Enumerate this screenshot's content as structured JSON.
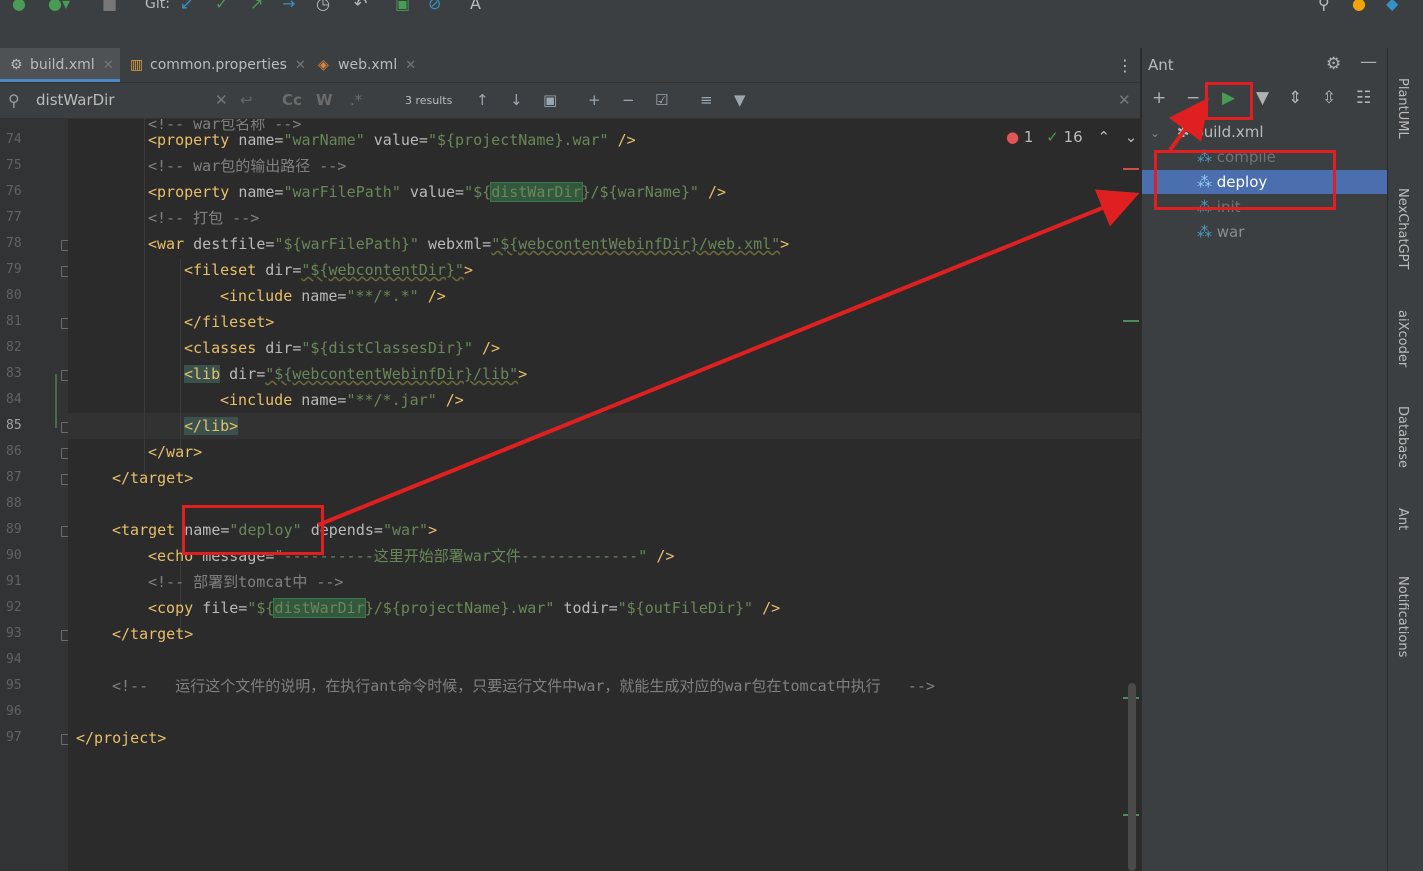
{
  "toolbar": {
    "git_label": "Git:"
  },
  "tabs": [
    {
      "label": "build.xml",
      "active": true,
      "icon": "ant-file-icon"
    },
    {
      "label": "common.properties",
      "active": false,
      "icon": "properties-file-icon"
    },
    {
      "label": "web.xml",
      "active": false,
      "icon": "xml-file-icon"
    }
  ],
  "search": {
    "query": "distWarDir",
    "results": "3 results",
    "match_case": "Cc",
    "words": "W",
    "regex": ".*"
  },
  "inspections": {
    "errors": "1",
    "warnings": "16"
  },
  "lines": [
    "74",
    "75",
    "76",
    "77",
    "78",
    "79",
    "80",
    "81",
    "82",
    "83",
    "84",
    "85",
    "86",
    "87",
    "88",
    "89",
    "90",
    "91",
    "92",
    "93",
    "94",
    "95",
    "96",
    "97"
  ],
  "current_line": "85",
  "code": {
    "l74_pre": "<!-- war包名称 -->",
    "l74": [
      "<",
      "property",
      " name=",
      "\"warName\"",
      " value=",
      "\"${projectName}.war\"",
      " />"
    ],
    "l75": "<!-- war包的输出路径 -->",
    "l76a": "\"${",
    "l76b": "distWarDir",
    "l76c": "}/${warName}\"",
    "l77": "<!-- 打包 -->",
    "l78": "\"${warFilePath}\"",
    "l78b": "\"${webcontentWebinfDir}/web.xml\"",
    "l79": "\"${webcontentDir}\"",
    "l80": "\"**/*.*\"",
    "l82": "\"${distClassesDir}\"",
    "l83": "\"${webcontentWebinfDir}/lib\"",
    "l84": "\"**/*.jar\"",
    "l89a": "\"deploy\"",
    "l89b": "\"war\"",
    "l90": "\"----------这里开始部署war文件-------------\"",
    "l91": "<!-- 部署到tomcat中 -->",
    "l92a": "\"${",
    "l92b": "distWarDir",
    "l92c": "}/${projectName}.war\"",
    "l92d": "\"${outFileDir}\"",
    "l95": "<!--   运行这个文件的说明，在执行ant命令时候，只要运行文件中war，就能生成对应的war包在tomcat中执行   -->"
  },
  "ant_panel": {
    "title": "Ant",
    "root": "build.xml",
    "targets": [
      "compile",
      "deploy",
      "init",
      "war"
    ],
    "selected": "deploy"
  },
  "rail": [
    "PlantUML",
    "NexChatGPT",
    "aiXcoder",
    "Database",
    "Ant",
    "Notifications"
  ],
  "colors": {
    "annotation": "#e02020",
    "selection": "#4b6eaf",
    "run": "#499c54"
  }
}
